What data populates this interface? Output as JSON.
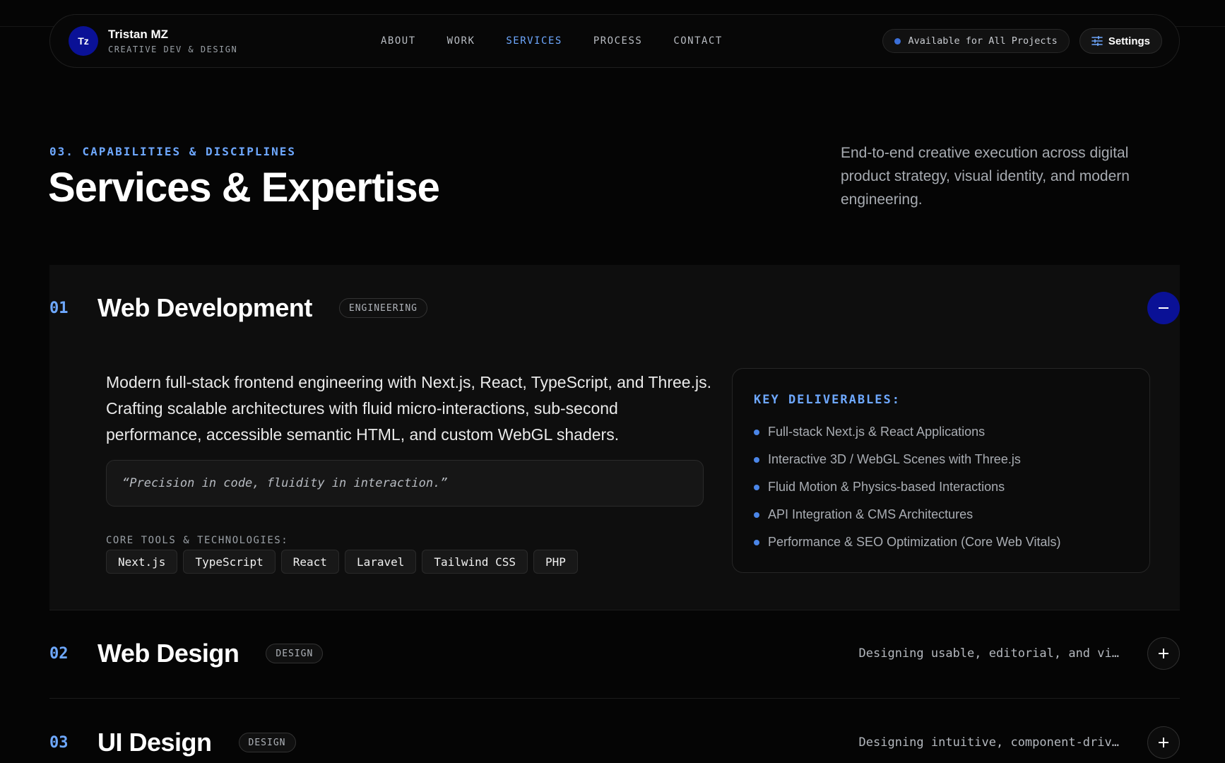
{
  "header": {
    "logo": "Tz",
    "brand_name": "Tristan MZ",
    "brand_sub": "CREATIVE DEV & DESIGN",
    "nav": [
      {
        "label": "ABOUT",
        "active": false
      },
      {
        "label": "WORK",
        "active": false
      },
      {
        "label": "SERVICES",
        "active": true
      },
      {
        "label": "PROCESS",
        "active": false
      },
      {
        "label": "CONTACT",
        "active": false
      }
    ],
    "availability": "Available for All Projects",
    "settings_label": "Settings"
  },
  "section": {
    "eyebrow": "03. CAPABILITIES & DISCIPLINES",
    "title": "Services & Expertise",
    "lede": "End-to-end creative execution across digital product strategy, visual identity, and modern engineering."
  },
  "services": [
    {
      "num": "01",
      "name": "Web Development",
      "tag": "ENGINEERING",
      "expanded": true,
      "description": "Modern full-stack frontend engineering with Next.js, React, TypeScript, and Three.js. Crafting scalable architectures with fluid micro-interactions, sub-second performance, accessible semantic HTML, and custom WebGL shaders.",
      "quote": "“Precision in code, fluidity in interaction.”",
      "tools_label": "CORE TOOLS & TECHNOLOGIES:",
      "tools": [
        "Next.js",
        "TypeScript",
        "React",
        "Laravel",
        "Tailwind CSS",
        "PHP"
      ],
      "deliverables_title": "KEY DELIVERABLES:",
      "deliverables": [
        "Full-stack Next.js & React Applications",
        "Interactive 3D / WebGL Scenes with Three.js",
        "Fluid Motion & Physics-based Interactions",
        "API Integration & CMS Architectures",
        "Performance & SEO Optimization (Core Web Vitals)"
      ]
    },
    {
      "num": "02",
      "name": "Web Design",
      "tag": "DESIGN",
      "expanded": false,
      "summary": "Designing usable, editorial, and vi…"
    },
    {
      "num": "03",
      "name": "UI Design",
      "tag": "DESIGN",
      "expanded": false,
      "summary": "Designing intuitive, component-driv…"
    }
  ],
  "colors": {
    "accent": "#6ea8ff",
    "brand": "#0a1196",
    "background": "#050505"
  },
  "icons": {
    "settings": "sliders-icon",
    "collapse": "minus-icon",
    "expand": "plus-icon"
  }
}
